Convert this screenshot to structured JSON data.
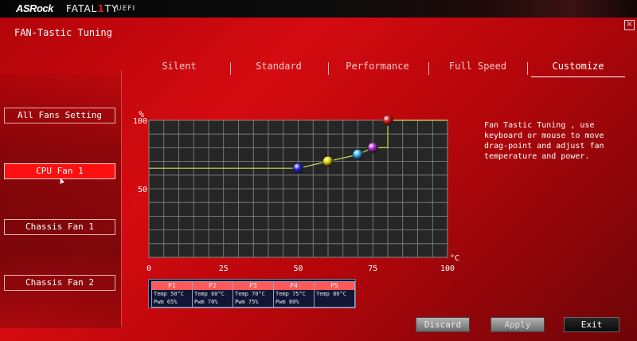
{
  "header": {
    "brand": "ASRock",
    "product": "FATAL",
    "product_t": "1",
    "product_end": "TY",
    "uefi": "UEFI",
    "close_label": "×"
  },
  "page_title": "FAN-Tastic Tuning",
  "sidebar": {
    "items": [
      {
        "label": "All Fans Setting",
        "selected": false
      },
      {
        "label": "CPU Fan 1",
        "selected": true
      },
      {
        "label": "Chassis Fan 1",
        "selected": false
      },
      {
        "label": "Chassis Fan 2",
        "selected": false
      }
    ]
  },
  "tabs": [
    {
      "label": "Silent",
      "active": false
    },
    {
      "label": "Standard",
      "active": false
    },
    {
      "label": "Performance",
      "active": false
    },
    {
      "label": "Full Speed",
      "active": false
    },
    {
      "label": "Customize",
      "active": true
    }
  ],
  "description": "Fan Tastic Tuning , use keyboard or mouse to move drag-point and adjust fan temperature and power.",
  "chart_data": {
    "type": "line",
    "ylabel": "%",
    "xlabel": "°C",
    "xlim": [
      0,
      100
    ],
    "ylim": [
      0,
      100
    ],
    "x_ticks": [
      "0",
      "25",
      "50",
      "75",
      "100"
    ],
    "y_ticks": [
      "50",
      "100"
    ],
    "grid": true,
    "curve": [
      {
        "x": 0,
        "y": 65
      },
      {
        "x": 50,
        "y": 65
      },
      {
        "x": 60,
        "y": 70
      },
      {
        "x": 70,
        "y": 75
      },
      {
        "x": 75,
        "y": 80
      },
      {
        "x": 80,
        "y": 80
      },
      {
        "x": 80,
        "y": 100
      },
      {
        "x": 100,
        "y": 100
      }
    ],
    "points": [
      {
        "name": "P1",
        "temp": 50,
        "pwm": 65,
        "color": "#2626d6"
      },
      {
        "name": "P2",
        "temp": 60,
        "pwm": 70,
        "color": "#e6d800"
      },
      {
        "name": "P3",
        "temp": 70,
        "pwm": 75,
        "color": "#2fb0ee"
      },
      {
        "name": "P4",
        "temp": 75,
        "pwm": 80,
        "color": "#b02ad6"
      },
      {
        "name": "P5",
        "temp": 80,
        "pwm": 100,
        "color": "#e01818"
      }
    ],
    "line_color": "#c8e05a"
  },
  "point_panel": [
    {
      "name": "P1",
      "temp": "Temp 50°C",
      "pwm": "Pwm  65%"
    },
    {
      "name": "P2",
      "temp": "Temp 60°C",
      "pwm": "Pwm  70%"
    },
    {
      "name": "P3",
      "temp": "Temp 70°C",
      "pwm": "Pwm  75%"
    },
    {
      "name": "P4",
      "temp": "Temp 75°C",
      "pwm": "Pwm  80%"
    },
    {
      "name": "P5",
      "temp": "Temp 80°C",
      "pwm": ""
    }
  ],
  "buttons": {
    "discard": "Discard",
    "apply": "Apply",
    "exit": "Exit"
  }
}
